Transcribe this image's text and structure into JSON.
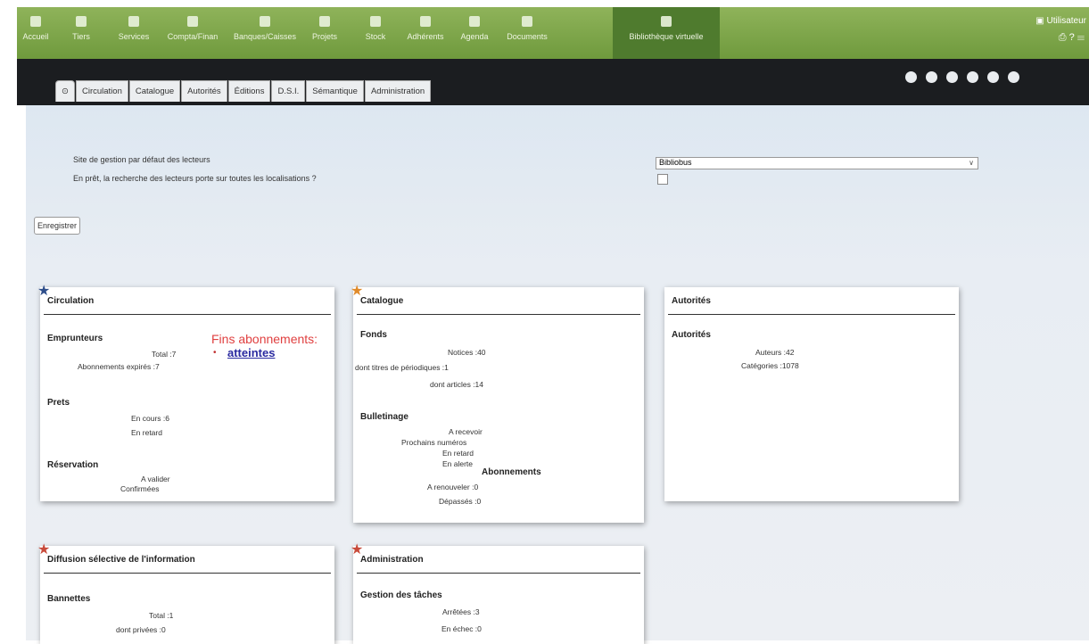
{
  "nav": {
    "items": [
      "Accueil",
      "Tiers",
      "Services",
      "Compta/Finan",
      "Banques/Caisses",
      "Projets",
      "Stock",
      "Adhérents",
      "Agenda",
      "Documents",
      "Bibliothèque virtuelle"
    ],
    "user": "Utilisateur",
    "colors": {
      "bar": "#7ea64a",
      "active": "#4f7b2e"
    }
  },
  "tabs": [
    "Circulation",
    "Catalogue",
    "Autorités",
    "Éditions",
    "D.S.I.",
    "Sémantique",
    "Administration"
  ],
  "settings": {
    "label1": "Site de gestion par défaut des lecteurs",
    "label2": "En prêt, la recherche des lecteurs porte sur toutes les localisations ?",
    "select_value": "Bibliobus",
    "save_label": "Enregistrer"
  },
  "circulation": {
    "title": "Circulation",
    "emprunteurs": "Emprunteurs",
    "total": "Total :7",
    "abonnements_expires": "Abonnements expirés :7",
    "fins_title": "Fins abonnements:",
    "fins_link": "atteintes",
    "prets": "Prets",
    "en_cours": "En cours :6",
    "en_retard": "En retard",
    "reservation": "Réservation",
    "a_valider": "A valider",
    "confirmees": "Confirmées"
  },
  "catalogue": {
    "title": "Catalogue",
    "fonds": "Fonds",
    "notices": "Notices :40",
    "dont_titres": "dont titres de périodiques :1",
    "dont_articles": "dont articles :14",
    "bulletinage": "Bulletinage",
    "a_recevoir": "A recevoir",
    "prochains": "Prochains numéros",
    "en_retard": "En retard",
    "en_alerte": "En alerte",
    "abonnements": "Abonnements",
    "a_renouveler": "A renouveler :0",
    "depasses": "Dépassés :0"
  },
  "autorites": {
    "title": "Autorités",
    "sub": "Autorités",
    "auteurs": "Auteurs :42",
    "categories": "Catégories :1078"
  },
  "dsi": {
    "title": "Diffusion sélective de l'information",
    "bannettes": "Bannettes",
    "total": "Total :1",
    "dont_privees": "dont privées :0"
  },
  "administration": {
    "title": "Administration",
    "gestion": "Gestion des tâches",
    "arretees": "Arrêtées :3",
    "en_echec": "En échec :0"
  }
}
